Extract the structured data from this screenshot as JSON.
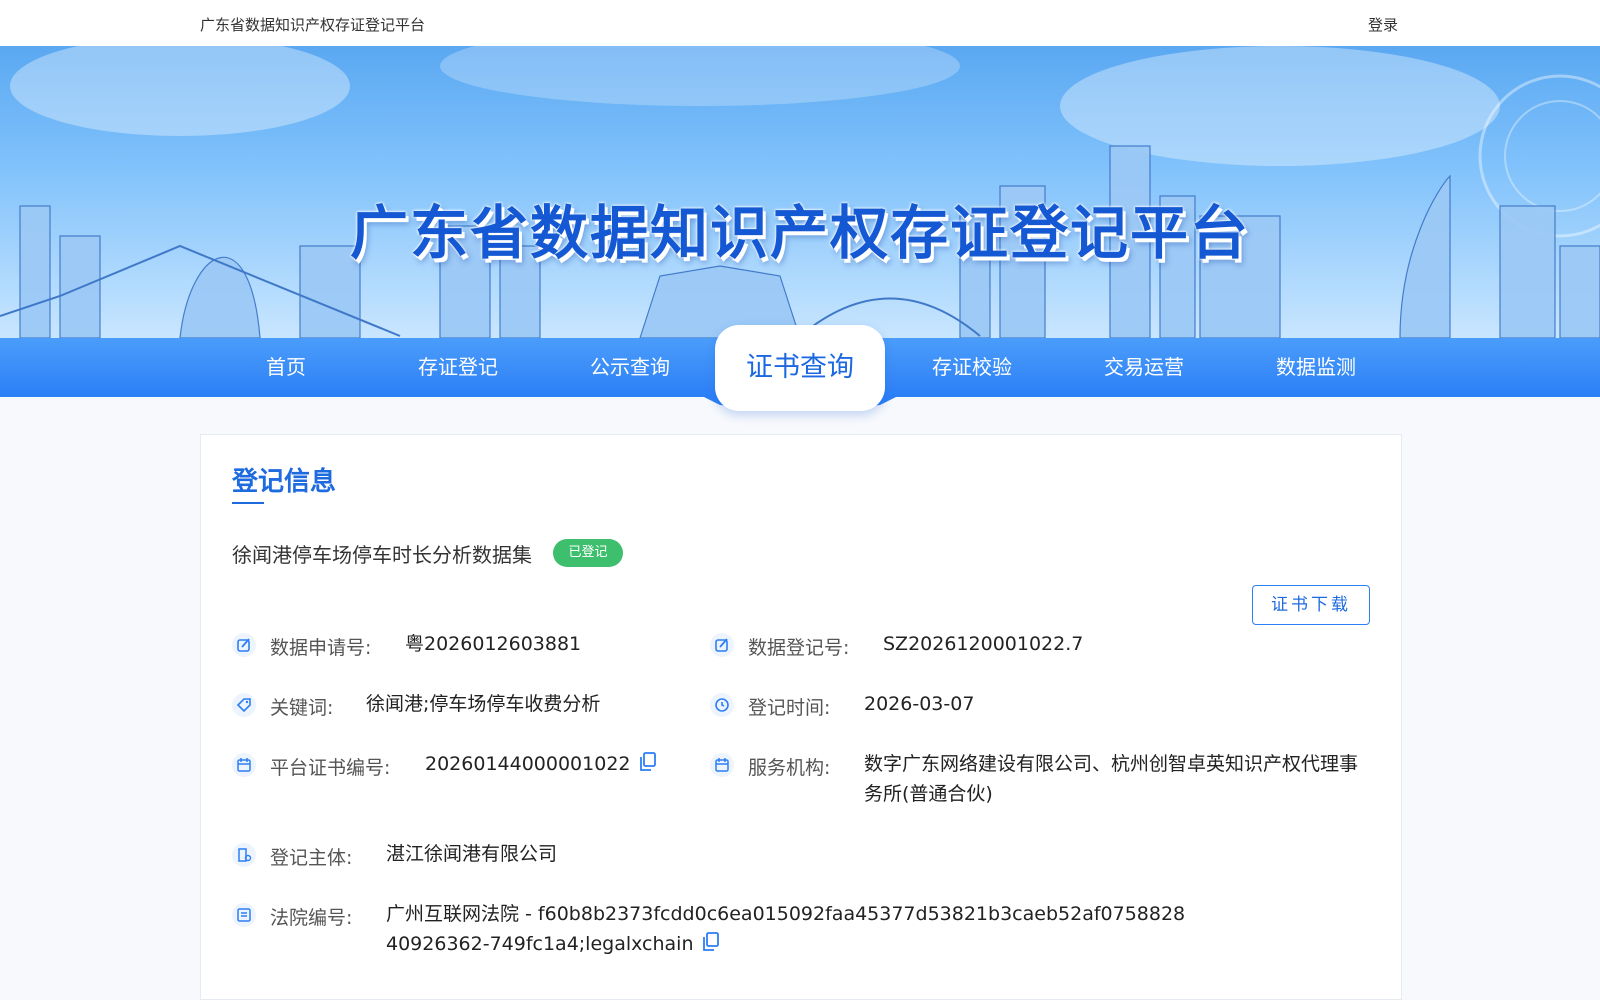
{
  "topbar": {
    "brand": "广东省数据知识产权存证登记平台",
    "login": "登录"
  },
  "banner": {
    "title": "广东省数据知识产权存证登记平台"
  },
  "nav": {
    "items": [
      "首页",
      "存证登记",
      "公示查询",
      "证书查询",
      "存证校验",
      "交易运营",
      "数据监测"
    ],
    "active_index": 3
  },
  "section": {
    "title": "登记信息"
  },
  "record": {
    "title": "徐闻港停车场停车时长分析数据集",
    "status": "已登记",
    "download_label": "证书下载"
  },
  "fields": {
    "application_no": {
      "label": "数据申请号:",
      "value": "粤2026012603881"
    },
    "registration_no": {
      "label": "数据登记号:",
      "value": "SZ2026120001022.7"
    },
    "keywords": {
      "label": "关键词:",
      "value": "徐闻港;停车场停车收费分析"
    },
    "registration_time": {
      "label": "登记时间:",
      "value": "2026-03-07"
    },
    "cert_no": {
      "label": "平台证书编号:",
      "value": "20260144000001022"
    },
    "service_org": {
      "label": "服务机构:",
      "value": "数字广东网络建设有限公司、杭州创智卓英知识产权代理事务所(普通合伙)"
    },
    "subject": {
      "label": "登记主体:",
      "value": "湛江徐闻港有限公司"
    },
    "court_no": {
      "label": "法院编号:",
      "value": "广州互联网法院 - f60b8b2373fcdd0c6ea015092faa45377d53821b3caeb52af075882840926362-749fc1a4;legalxchain"
    }
  },
  "colors": {
    "accent": "#1e6be0",
    "nav": "#2c7ff5",
    "badge": "#3dbf6e"
  }
}
